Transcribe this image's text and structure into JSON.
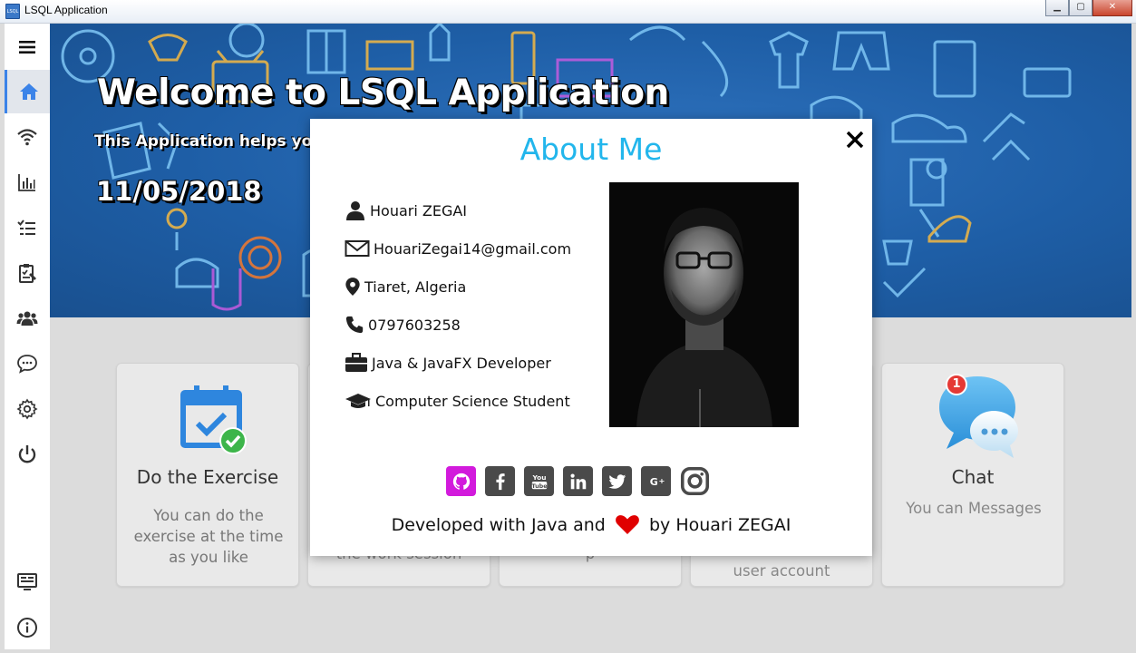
{
  "window": {
    "title": "LSQL Application",
    "app_icon_text": "LSQL",
    "controls": [
      "minimize",
      "maximize",
      "close"
    ]
  },
  "sidebar": {
    "items": [
      {
        "name": "menu-icon",
        "active": false
      },
      {
        "name": "home-icon",
        "active": true
      },
      {
        "name": "wifi-icon",
        "active": false
      },
      {
        "name": "chart-icon",
        "active": false
      },
      {
        "name": "checklist-icon",
        "active": false
      },
      {
        "name": "clipboard-icon",
        "active": false
      },
      {
        "name": "users-icon",
        "active": false
      },
      {
        "name": "chat-icon",
        "active": false
      },
      {
        "name": "settings-icon",
        "active": false
      },
      {
        "name": "power-icon",
        "active": false
      },
      {
        "name": "monitor-icon",
        "active": false
      },
      {
        "name": "info-icon",
        "active": false
      }
    ],
    "accent": "#3b83e8"
  },
  "banner": {
    "title": "Welcome to LSQL Application",
    "subtitle": "This Application helps you",
    "date": "11/05/2018"
  },
  "cards": [
    {
      "title": "Do the Exercise",
      "desc": "You can do the exercise at the time as you like",
      "icon": "calendar-check-icon"
    },
    {
      "partial_text": "the work session"
    },
    {
      "partial_text": "p"
    },
    {
      "partial_text": "user account"
    },
    {
      "title": "Chat",
      "desc": "You can Messages",
      "icon": "chat-bubbles-icon",
      "badge": "1"
    }
  ],
  "about": {
    "title": "About Me",
    "name": "Houari ZEGAI",
    "email": "HouariZegai14@gmail.com",
    "location": "Tiaret, Algeria",
    "phone": "0797603258",
    "job": "Java & JavaFX Developer",
    "education": "Computer Science Student",
    "socials": [
      "github-icon",
      "facebook-icon",
      "youtube-icon",
      "linkedin-icon",
      "twitter-icon",
      "google-plus-icon",
      "instagram-icon"
    ],
    "footer_before": "Developed with Java and",
    "footer_after": "by Houari ZEGAI",
    "title_color": "#22b6ec",
    "heart_color": "#e00000",
    "github_color": "#d21adc"
  }
}
